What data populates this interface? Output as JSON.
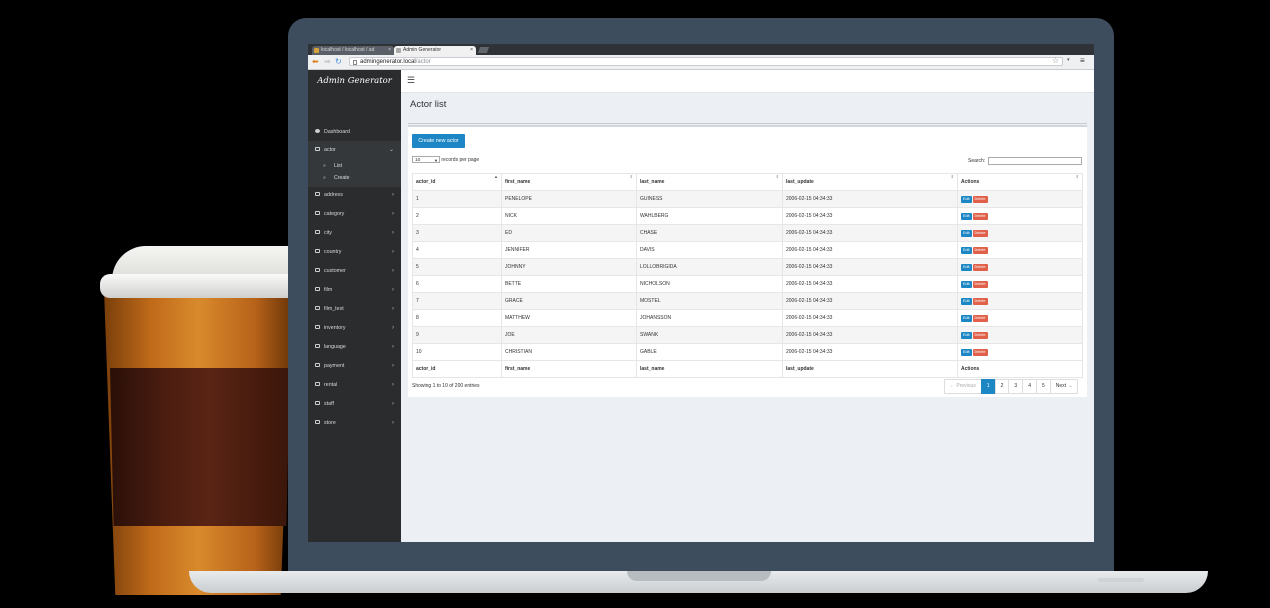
{
  "browser": {
    "tabs": [
      {
        "label": "localhost / localhost / ad"
      },
      {
        "label": "Admin Generator"
      }
    ],
    "url_host": "admingenerator.local",
    "url_path": "/actor"
  },
  "sidebar": {
    "brand": "Admin Generator",
    "items": [
      {
        "label": "Dashboard",
        "icon": "dashboard-icon"
      },
      {
        "label": "actor",
        "icon": "folder-icon",
        "open": true,
        "children": [
          {
            "label": "List"
          },
          {
            "label": "Create"
          }
        ]
      },
      {
        "label": "address",
        "icon": "folder-icon"
      },
      {
        "label": "category",
        "icon": "folder-icon"
      },
      {
        "label": "city",
        "icon": "folder-icon"
      },
      {
        "label": "country",
        "icon": "folder-icon"
      },
      {
        "label": "customer",
        "icon": "folder-icon"
      },
      {
        "label": "film",
        "icon": "folder-icon"
      },
      {
        "label": "film_text",
        "icon": "folder-icon"
      },
      {
        "label": "inventory",
        "icon": "folder-icon"
      },
      {
        "label": "language",
        "icon": "folder-icon"
      },
      {
        "label": "payment",
        "icon": "folder-icon"
      },
      {
        "label": "rental",
        "icon": "folder-icon"
      },
      {
        "label": "staff",
        "icon": "folder-icon"
      },
      {
        "label": "store",
        "icon": "folder-icon"
      }
    ]
  },
  "main": {
    "title": "Actor list",
    "create_button": "Create new actor",
    "page_length": "10",
    "records_per_page": "records per page",
    "search_label": "Search:",
    "search_value": "",
    "columns": [
      "actor_id",
      "first_name",
      "last_name",
      "last_update",
      "Actions"
    ],
    "rows": [
      [
        "1",
        "PENELOPE",
        "GUINESS",
        "2006-02-15 04:34:33"
      ],
      [
        "2",
        "NICK",
        "WAHLBERG",
        "2006-02-15 04:34:33"
      ],
      [
        "3",
        "ED",
        "CHASE",
        "2006-02-15 04:34:33"
      ],
      [
        "4",
        "JENNIFER",
        "DAVIS",
        "2006-02-15 04:34:33"
      ],
      [
        "5",
        "JOHNNY",
        "LOLLOBRIGIDA",
        "2006-02-15 04:34:33"
      ],
      [
        "6",
        "BETTE",
        "NICHOLSON",
        "2006-02-15 04:34:33"
      ],
      [
        "7",
        "GRACE",
        "MOSTEL",
        "2006-02-15 04:34:33"
      ],
      [
        "8",
        "MATTHEW",
        "JOHANSSON",
        "2006-02-15 04:34:33"
      ],
      [
        "9",
        "JOE",
        "SWANK",
        "2006-02-15 04:34:33"
      ],
      [
        "10",
        "CHRISTIAN",
        "GABLE",
        "2006-02-15 04:34:33"
      ]
    ],
    "edit_label": "Edit",
    "delete_label": "Delete",
    "info": "Showing 1 to 10 of 200 entries",
    "pagination": {
      "previous": "← Previous",
      "pages": [
        "1",
        "2",
        "3",
        "4",
        "5"
      ],
      "active_page": "1",
      "next": "Next →"
    }
  },
  "colors": {
    "primary": "#1c87c4",
    "danger": "#e0604a",
    "sidebar_bg": "#2a2c2e"
  }
}
